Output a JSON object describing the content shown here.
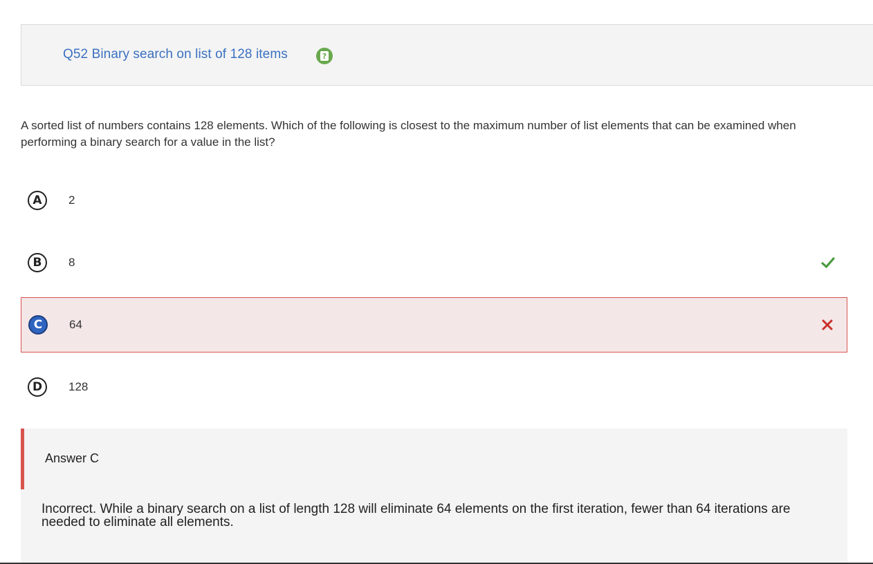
{
  "header": {
    "title": "Q52 Binary search on list of 128 items",
    "help_icon": "help-icon",
    "help_icon_color": "#6aa84f"
  },
  "question": {
    "text": "A sorted list of numbers contains 128 elements. Which of the following is closest to the maximum number of list elements that can be examined when performing a binary search for a value in the list?"
  },
  "options": [
    {
      "letter": "A",
      "text": "2"
    },
    {
      "letter": "B",
      "text": "8",
      "status": "correct"
    },
    {
      "letter": "C",
      "text": "64",
      "status": "selected-incorrect"
    },
    {
      "letter": "D",
      "text": "128"
    }
  ],
  "answer": {
    "title": "Answer C",
    "explanation": "Incorrect. While a binary search on a list of length 128 will eliminate 64 elements on the first iteration, fewer than 64 iterations are needed to eliminate all elements."
  },
  "colors": {
    "title_blue": "#3b71c1",
    "correct_green": "#4a9a3f",
    "incorrect_red": "#c9302c",
    "selected_bg": "#f4e7e7"
  }
}
